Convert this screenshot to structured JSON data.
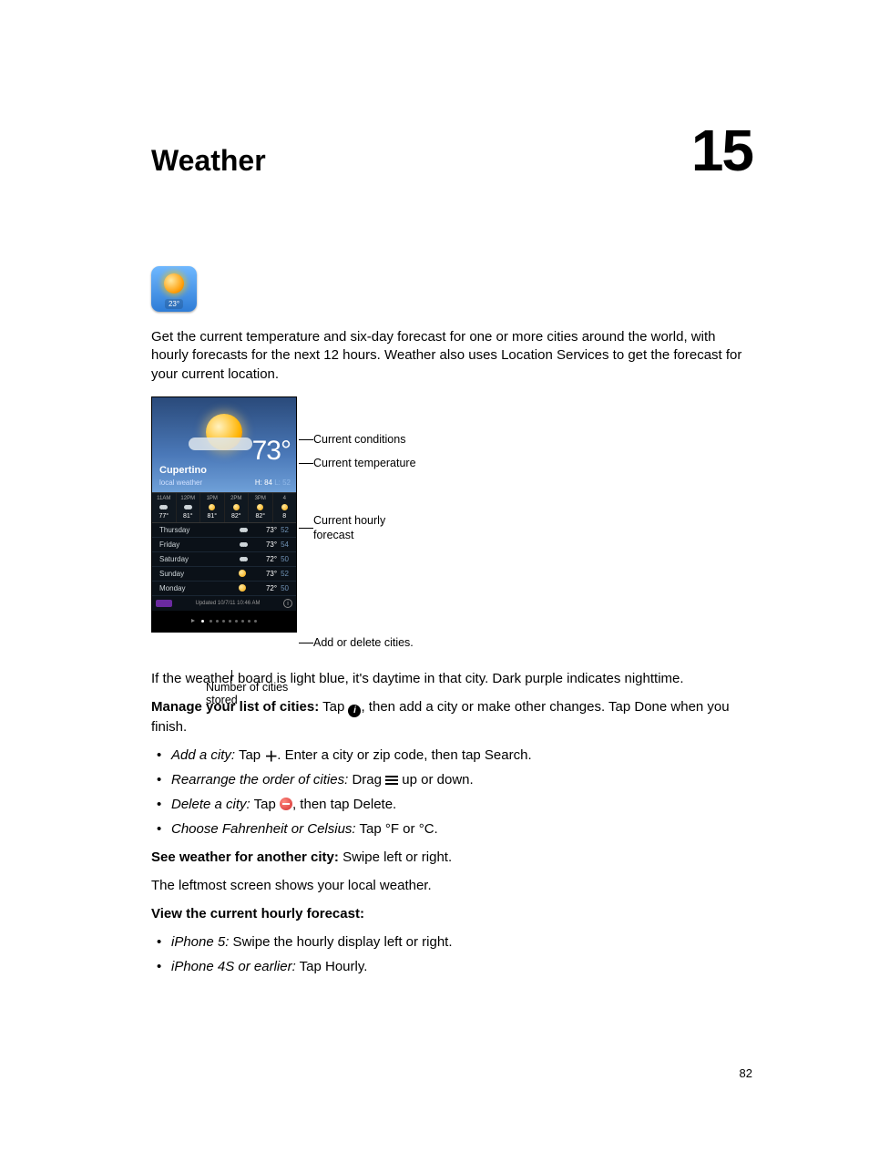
{
  "chapter": {
    "title": "Weather",
    "number": "15"
  },
  "appIcon": {
    "badge": "23°"
  },
  "intro": "Get the current temperature and six-day forecast for one or more cities around the world, with hourly forecasts for the next 12 hours. Weather also uses Location Services to get the forecast for your current location.",
  "screenshot": {
    "city": "Cupertino",
    "subtitle": "local weather",
    "temp": "73°",
    "hi": "H: 84",
    "lo": "L: 52",
    "hourly": [
      {
        "label": "11AM",
        "temp": "77°",
        "icon": "cloudy"
      },
      {
        "label": "12PM",
        "temp": "81°",
        "icon": "cloudy"
      },
      {
        "label": "1PM",
        "temp": "81°",
        "icon": "sunny"
      },
      {
        "label": "2PM",
        "temp": "82°",
        "icon": "sunny"
      },
      {
        "label": "3PM",
        "temp": "82°",
        "icon": "sunny"
      },
      {
        "label": "4",
        "temp": "8",
        "icon": "sunny"
      }
    ],
    "days": [
      {
        "name": "Thursday",
        "hi": "73°",
        "lo": "52",
        "icon": "cloudy"
      },
      {
        "name": "Friday",
        "hi": "73°",
        "lo": "54",
        "icon": "cloudy"
      },
      {
        "name": "Saturday",
        "hi": "72°",
        "lo": "50",
        "icon": "cloudy"
      },
      {
        "name": "Sunday",
        "hi": "73°",
        "lo": "52",
        "icon": "sunny"
      },
      {
        "name": "Monday",
        "hi": "72°",
        "lo": "50",
        "icon": "sunny"
      }
    ],
    "updated": "Updated 10/7/11 10:46 AM",
    "infoGlyph": "i"
  },
  "callouts": {
    "conditions": "Current conditions",
    "temperature": "Current temperature",
    "hourly1": "Current hourly",
    "hourly2": "forecast",
    "addDelete": "Add or delete cities.",
    "numberStored": "Number of cities stored"
  },
  "paragraphs": {
    "daytime": "If the weather board is light blue, it's daytime in that city. Dark purple indicates nighttime.",
    "manage_label": "Manage your list of cities:",
    "manage_pre": "  Tap ",
    "manage_post": ", then add a city or make other changes. Tap Done when you finish.",
    "see_label": "See weather for another city:",
    "see_text": "  Swipe left or right.",
    "leftmost": "The leftmost screen shows your local weather.",
    "view_label": "View the current hourly forecast:"
  },
  "bullets1": {
    "add_em": "Add a city:",
    "add_pre": "  Tap ",
    "add_post": ". Enter a city or zip code, then tap Search.",
    "rearr_em": "Rearrange the order of cities:",
    "rearr_pre": "  Drag ",
    "rearr_post": " up or down.",
    "del_em": "Delete a city:",
    "del_pre": "  Tap ",
    "del_post": ", then tap Delete.",
    "choose_em": "Choose Fahrenheit or Celsius:",
    "choose_text": "  Tap °F or °C."
  },
  "bullets2": {
    "ip5_em": "iPhone 5:",
    "ip5_text": "  Swipe the hourly display left or right.",
    "ip4s_em": "iPhone 4S or earlier:",
    "ip4s_text": "  Tap Hourly."
  },
  "icons": {
    "info": "i",
    "plus": "＋"
  },
  "pageNumber": "82"
}
